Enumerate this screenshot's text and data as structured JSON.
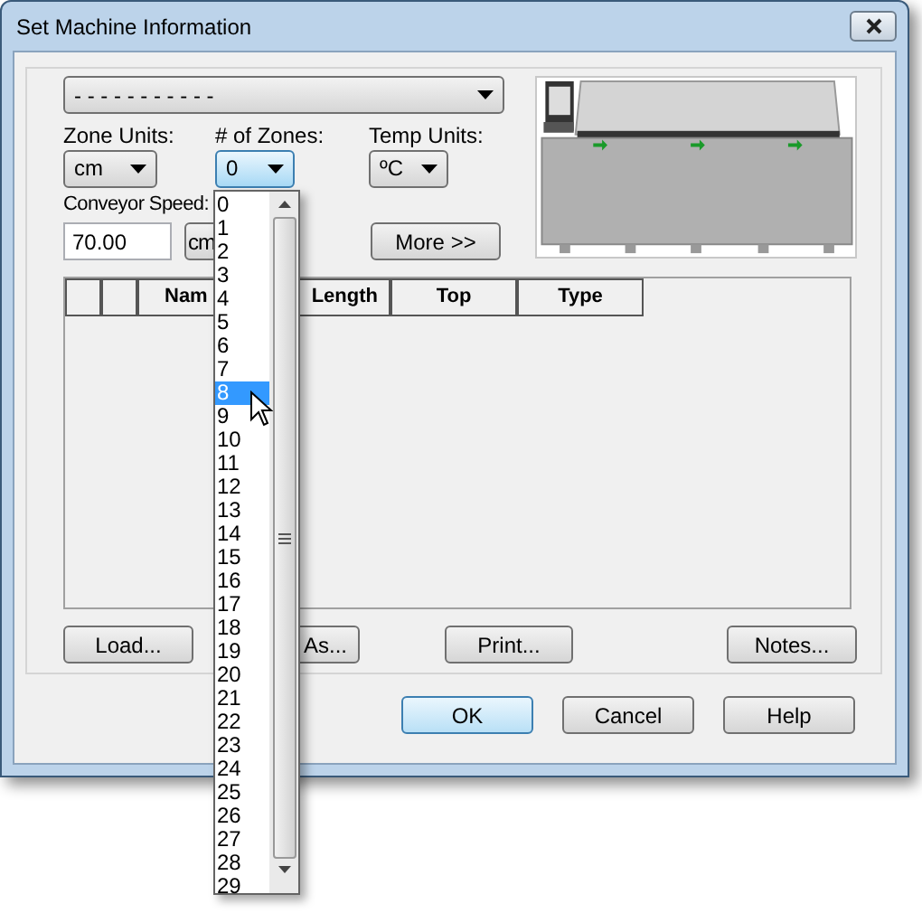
{
  "window": {
    "title": "Set Machine Information"
  },
  "machine_select": {
    "value": "- - - - - - - - - - -"
  },
  "zone_units": {
    "label": "Zone Units:",
    "value": "cm"
  },
  "zones": {
    "label": "# of Zones:",
    "value": "0",
    "open": true
  },
  "temp_units": {
    "label": "Temp Units:",
    "value": "ºC"
  },
  "conveyor_speed": {
    "label": "Conveyor Speed:",
    "value": "70.00",
    "unit": "cm"
  },
  "more_button": "More >>",
  "table": {
    "columns": [
      "Nam",
      "Length",
      "Top",
      "Type"
    ]
  },
  "file_buttons": [
    "Load...",
    "As...",
    "Print...",
    "Notes..."
  ],
  "dialog_buttons": [
    {
      "label": "OK",
      "default": true
    },
    {
      "label": "Cancel",
      "default": false
    },
    {
      "label": "Help",
      "default": false
    }
  ],
  "zone_list": {
    "items": [
      {
        "label": "0",
        "selected": false
      },
      {
        "label": "1",
        "selected": false
      },
      {
        "label": "2",
        "selected": false
      },
      {
        "label": "3",
        "selected": false
      },
      {
        "label": "4",
        "selected": false
      },
      {
        "label": "5",
        "selected": false
      },
      {
        "label": "6",
        "selected": false
      },
      {
        "label": "7",
        "selected": false
      },
      {
        "label": "8",
        "selected": true
      },
      {
        "label": "9",
        "selected": false
      },
      {
        "label": "10",
        "selected": false
      },
      {
        "label": "11",
        "selected": false
      },
      {
        "label": "12",
        "selected": false
      },
      {
        "label": "13",
        "selected": false
      },
      {
        "label": "14",
        "selected": false
      },
      {
        "label": "15",
        "selected": false
      },
      {
        "label": "16",
        "selected": false
      },
      {
        "label": "17",
        "selected": false
      },
      {
        "label": "18",
        "selected": false
      },
      {
        "label": "19",
        "selected": false
      },
      {
        "label": "20",
        "selected": false
      },
      {
        "label": "21",
        "selected": false
      },
      {
        "label": "22",
        "selected": false
      },
      {
        "label": "23",
        "selected": false
      },
      {
        "label": "24",
        "selected": false
      },
      {
        "label": "25",
        "selected": false
      },
      {
        "label": "26",
        "selected": false
      },
      {
        "label": "27",
        "selected": false
      },
      {
        "label": "28",
        "selected": false
      },
      {
        "label": "29",
        "selected": false
      }
    ]
  }
}
